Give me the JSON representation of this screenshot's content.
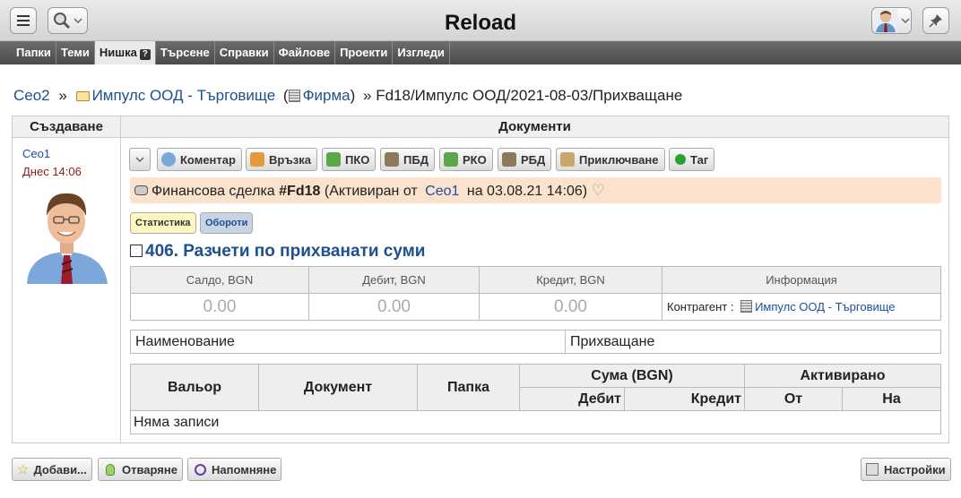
{
  "app": {
    "title": "Reload"
  },
  "menu": [
    {
      "label": "Папки"
    },
    {
      "label": "Теми"
    },
    {
      "label": "Нишка",
      "help": "?"
    },
    {
      "label": "Търсене"
    },
    {
      "label": "Справки"
    },
    {
      "label": "Файлове"
    },
    {
      "label": "Проекти"
    },
    {
      "label": "Изгледи"
    }
  ],
  "breadcrumb": {
    "user": "Ceo2",
    "sep": "»",
    "folder": "Импулс ООД - Търговище",
    "paren_open": "(",
    "firm": "Фирма",
    "paren_close": ")",
    "path": "» Fd18/Импулс ООД/2021-08-03/Прихващане"
  },
  "columns": {
    "created": "Създаване",
    "documents": "Документи"
  },
  "author": {
    "name": "Ceo1",
    "date": "Днес 14:06"
  },
  "actions": [
    {
      "label": "Коментар",
      "icon": "comment-icon",
      "color": "#7aa8d8"
    },
    {
      "label": "Връзка",
      "icon": "link-icon",
      "color": "#e59a3a"
    },
    {
      "label": "ПКО",
      "icon": "cash-in-icon",
      "color": "#5aa84a"
    },
    {
      "label": "ПБД",
      "icon": "bank-in-icon",
      "color": "#8c7a5a"
    },
    {
      "label": "РКО",
      "icon": "cash-out-icon",
      "color": "#5aa84a"
    },
    {
      "label": "РБД",
      "icon": "bank-out-icon",
      "color": "#8c7a5a"
    },
    {
      "label": "Приключване",
      "icon": "lock-icon",
      "color": "#c9a66b"
    },
    {
      "label": "Таг",
      "icon": "tag-dot-icon",
      "color": "#2fa02f"
    }
  ],
  "deal": {
    "prefix": "Финансова сделка",
    "number": "#Fd18",
    "activated": "(Активиран от",
    "user": "Ceo1",
    "date": "на 03.08.21 14:06)"
  },
  "tabs": {
    "stats": "Статистика",
    "turnover": "Обороти"
  },
  "account": {
    "title": "406. Разчети по прихванати суми"
  },
  "summary": {
    "headers": [
      "Салдо, BGN",
      "Дебит, BGN",
      "Кредит, BGN",
      "Информация"
    ],
    "saldo": "0.00",
    "debit": "0.00",
    "credit": "0.00",
    "contractor_label": "Контрагент :",
    "contractor": "Импулс ООД - Търговище"
  },
  "name_row": {
    "label": "Наименование",
    "value": "Прихващане"
  },
  "register": {
    "valor": "Вальор",
    "document": "Документ",
    "folder": "Папка",
    "sum": "Сума (BGN)",
    "activated": "Активирано",
    "debit": "Дебит",
    "credit": "Кредит",
    "from": "От",
    "to": "На",
    "empty": "Няма записи"
  },
  "bottom": {
    "add": "Добави...",
    "open": "Отваряне",
    "remind": "Напомняне",
    "settings": "Настройки"
  }
}
